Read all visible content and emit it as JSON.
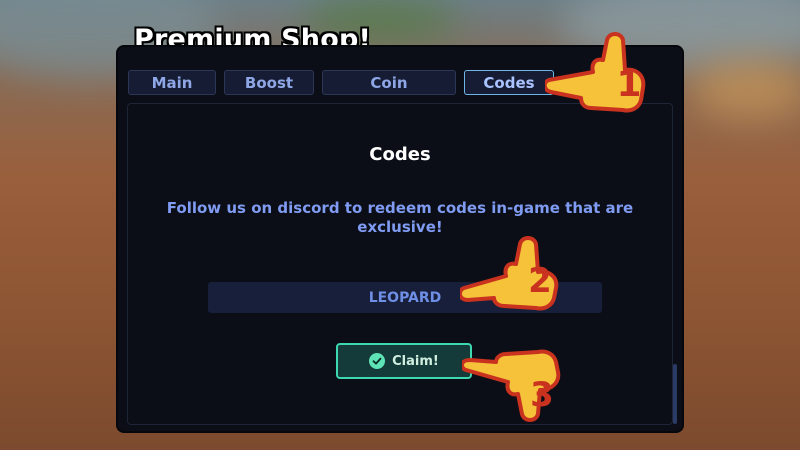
{
  "shop": {
    "title": "Premium Shop!",
    "tabs": [
      {
        "label": "Main"
      },
      {
        "label": "Boost"
      },
      {
        "label": "Coin"
      },
      {
        "label": "Codes"
      }
    ],
    "active_tab": "Codes"
  },
  "codes": {
    "heading": "Codes",
    "description": "Follow us on discord to redeem codes in-game that are exclusive!",
    "input_value": "LEOPARD",
    "claim_label": "Claim!"
  },
  "annotations": {
    "step1": "1",
    "step2": "2",
    "step3": "3"
  },
  "colors": {
    "panel_bg": "#0b0e16",
    "tab_bg": "#151c33",
    "accent_text": "#7f9bf2",
    "claim_border": "#3ed8b0",
    "pointer_fill": "#f5c23a",
    "pointer_outline": "#c8321e"
  },
  "icons": {
    "claim_icon": "check-circle-icon",
    "pointer_icon": "pointing-hand-icon"
  }
}
